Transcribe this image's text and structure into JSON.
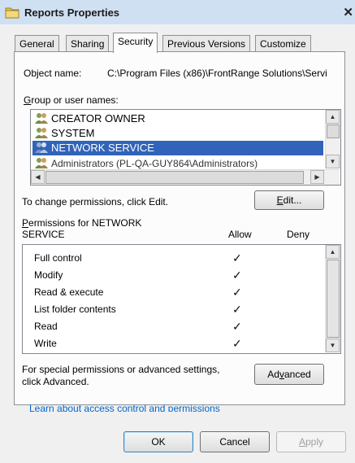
{
  "window": {
    "title": "Reports Properties",
    "close_glyph": "✕"
  },
  "tabs": [
    {
      "label": "General",
      "active": false
    },
    {
      "label": "Sharing",
      "active": false
    },
    {
      "label": "Security",
      "active": true
    },
    {
      "label": "Previous Versions",
      "active": false
    },
    {
      "label": "Customize",
      "active": false
    }
  ],
  "object": {
    "label": "Object name:",
    "value": "C:\\Program Files (x86)\\FrontRange Solutions\\Servi"
  },
  "groups": {
    "label_pre": "",
    "label_u": "G",
    "label_post": "roup or user names:",
    "items": [
      {
        "name": "CREATOR OWNER",
        "icon": "user-group-icon",
        "selected": false
      },
      {
        "name": "SYSTEM",
        "icon": "user-group-icon",
        "selected": false
      },
      {
        "name": "NETWORK SERVICE",
        "icon": "user-group-icon",
        "selected": true
      },
      {
        "name": "Administrators (PL-QA-GUY864\\Administrators)",
        "icon": "user-group-icon",
        "selected": false
      }
    ]
  },
  "change_hint": "To change permissions, click Edit.",
  "edit_button": {
    "pre": "",
    "u": "E",
    "post": "dit..."
  },
  "permissions": {
    "label_u": "P",
    "label_line1_post": "ermissions for NETWORK",
    "label_line2": "SERVICE",
    "allow_header": "Allow",
    "deny_header": "Deny",
    "rows": [
      {
        "name": "Full control",
        "allow": true,
        "deny": false
      },
      {
        "name": "Modify",
        "allow": true,
        "deny": false
      },
      {
        "name": "Read & execute",
        "allow": true,
        "deny": false
      },
      {
        "name": "List folder contents",
        "allow": true,
        "deny": false
      },
      {
        "name": "Read",
        "allow": true,
        "deny": false
      },
      {
        "name": "Write",
        "allow": true,
        "deny": false
      }
    ],
    "check_glyph": "✓"
  },
  "special": {
    "line1": "For special permissions or advanced settings,",
    "line2": "click Advanced."
  },
  "advanced_button": {
    "pre": "Ad",
    "u": "v",
    "post": "anced"
  },
  "learn_link": "Learn about access control and permissions",
  "footer": {
    "ok": "OK",
    "cancel": "Cancel",
    "apply_u": "A",
    "apply_post": "pply"
  }
}
